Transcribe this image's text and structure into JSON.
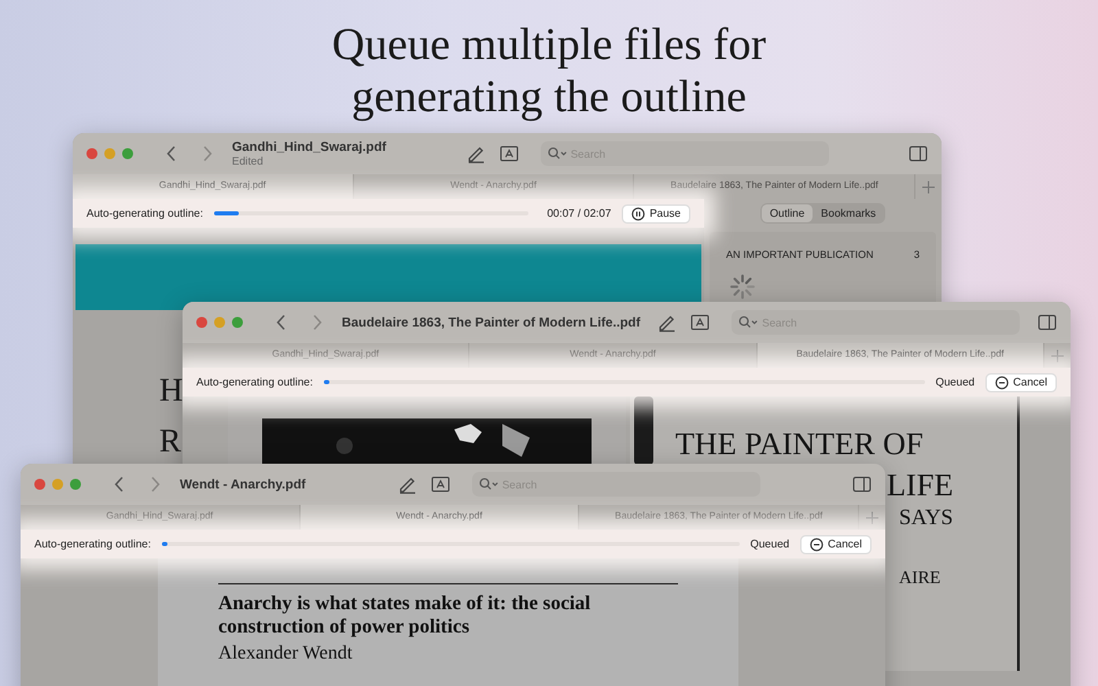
{
  "headline": [
    "Queue multiple files for",
    "generating the outline"
  ],
  "windows": [
    {
      "title": "Gandhi_Hind_Swaraj.pdf",
      "subtitle": "Edited",
      "search": {
        "placeholder": "Search"
      },
      "tabs": [
        {
          "label": "Gandhi_Hind_Swaraj.pdf",
          "selected": true
        },
        {
          "label": "Wendt - Anarchy.pdf",
          "selected": false
        },
        {
          "label": "Baudelaire 1863, The Painter of Modern Life..pdf",
          "selected": false
        }
      ],
      "progress": {
        "label": "Auto-generating outline:",
        "level": 0.08,
        "status": "00:07 / 02:07",
        "button": {
          "kind": "pause",
          "label": "Pause"
        }
      },
      "content": {
        "kind": "banner",
        "letters": [
          "H",
          "R"
        ]
      },
      "sidebar": {
        "segments": [
          {
            "label": "Outline",
            "selected": true
          },
          {
            "label": "Bookmarks",
            "selected": false
          }
        ],
        "items": [
          {
            "title": "AN IMPORTANT PUBLICATION",
            "page": "3"
          }
        ],
        "loading": true
      }
    },
    {
      "title": "Baudelaire 1863, The Painter of Modern Life..pdf",
      "search": {
        "placeholder": "Search"
      },
      "tabs": [
        {
          "label": "Gandhi_Hind_Swaraj.pdf",
          "selected": false
        },
        {
          "label": "Wendt - Anarchy.pdf",
          "selected": false
        },
        {
          "label": "Baudelaire 1863, The Painter of Modern Life..pdf",
          "selected": true
        }
      ],
      "progress": {
        "label": "Auto-generating outline:",
        "level": 0.01,
        "status": "Queued",
        "button": {
          "kind": "cancel",
          "label": "Cancel"
        }
      },
      "content": {
        "kind": "spread",
        "heading": "THE PAINTER OF",
        "lines": [
          "LIFE",
          "SAYS",
          "AIRE"
        ]
      }
    },
    {
      "title": "Wendt - Anarchy.pdf",
      "search": {
        "placeholder": "Search"
      },
      "tabs": [
        {
          "label": "Gandhi_Hind_Swaraj.pdf",
          "selected": false
        },
        {
          "label": "Wendt - Anarchy.pdf",
          "selected": true
        },
        {
          "label": "Baudelaire 1863, The Painter of Modern Life..pdf",
          "selected": false
        }
      ],
      "progress": {
        "label": "Auto-generating outline:",
        "level": 0.01,
        "status": "Queued",
        "button": {
          "kind": "cancel",
          "label": "Cancel"
        }
      },
      "content": {
        "kind": "article",
        "title": "Anarchy is what states make of it: the social construction of power politics",
        "author": "Alexander Wendt"
      }
    }
  ]
}
